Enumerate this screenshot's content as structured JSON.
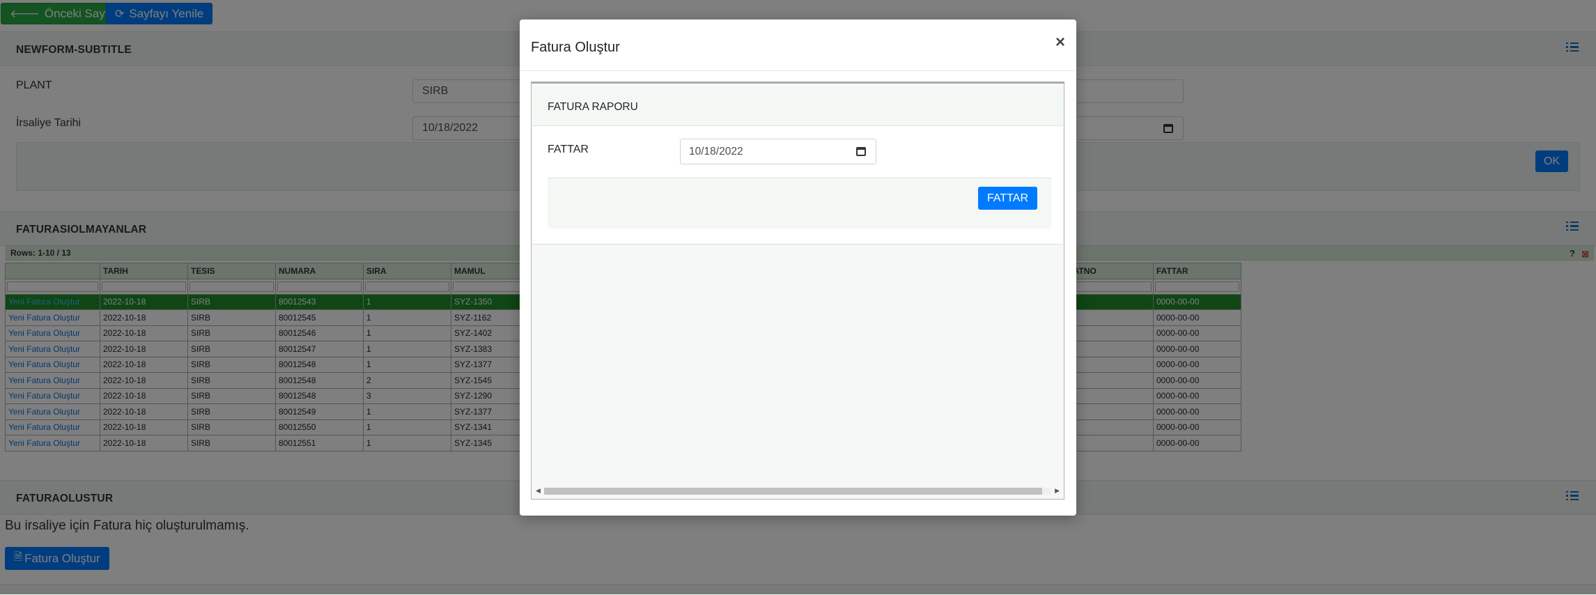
{
  "toolbar": {
    "back_label": "Önceki Sayfa",
    "refresh_label": "Sayfayı Yenile"
  },
  "form_panel": {
    "title": "NEWFORM-SUBTITLE",
    "plant_label": "PLANT",
    "plant_value": "SIRB",
    "date_label": "İrsaliye Tarihi",
    "date_value": "10/18/2022",
    "ok_label": "OK"
  },
  "report_panel": {
    "title": "FATURASIOLMAYANLAR",
    "rows_info": "Rows: 1-10 / 13",
    "help": "?",
    "columns": [
      "",
      "TARIH",
      "TESIS",
      "NUMARA",
      "SIRA",
      "MAMUL",
      "FATNO",
      "FATTAR"
    ],
    "rows": [
      {
        "link": "Yeni Fatura Oluştur",
        "tarih": "2022-10-18",
        "tesis": "SIRB",
        "numara": "80012543",
        "sira": "1",
        "mamul": "SYZ-1350",
        "fatno": "",
        "fattar": "0000-00-00"
      },
      {
        "link": "Yeni Fatura Oluştur",
        "tarih": "2022-10-18",
        "tesis": "SIRB",
        "numara": "80012545",
        "sira": "1",
        "mamul": "SYZ-1162",
        "fatno": "",
        "fattar": "0000-00-00"
      },
      {
        "link": "Yeni Fatura Oluştur",
        "tarih": "2022-10-18",
        "tesis": "SIRB",
        "numara": "80012546",
        "sira": "1",
        "mamul": "SYZ-1402",
        "fatno": "",
        "fattar": "0000-00-00"
      },
      {
        "link": "Yeni Fatura Oluştur",
        "tarih": "2022-10-18",
        "tesis": "SIRB",
        "numara": "80012547",
        "sira": "1",
        "mamul": "SYZ-1383",
        "fatno": "",
        "fattar": "0000-00-00"
      },
      {
        "link": "Yeni Fatura Oluştur",
        "tarih": "2022-10-18",
        "tesis": "SIRB",
        "numara": "80012548",
        "sira": "1",
        "mamul": "SYZ-1377",
        "fatno": "",
        "fattar": "0000-00-00"
      },
      {
        "link": "Yeni Fatura Oluştur",
        "tarih": "2022-10-18",
        "tesis": "SIRB",
        "numara": "80012548",
        "sira": "2",
        "mamul": "SYZ-1545",
        "fatno": "",
        "fattar": "0000-00-00"
      },
      {
        "link": "Yeni Fatura Oluştur",
        "tarih": "2022-10-18",
        "tesis": "SIRB",
        "numara": "80012548",
        "sira": "3",
        "mamul": "SYZ-1290",
        "fatno": "",
        "fattar": "0000-00-00"
      },
      {
        "link": "Yeni Fatura Oluştur",
        "tarih": "2022-10-18",
        "tesis": "SIRB",
        "numara": "80012549",
        "sira": "1",
        "mamul": "SYZ-1377",
        "fatno": "",
        "fattar": "0000-00-00"
      },
      {
        "link": "Yeni Fatura Oluştur",
        "tarih": "2022-10-18",
        "tesis": "SIRB",
        "numara": "80012550",
        "sira": "1",
        "mamul": "SYZ-1341",
        "fatno": "",
        "fattar": "0000-00-00"
      },
      {
        "link": "Yeni Fatura Oluştur",
        "tarih": "2022-10-18",
        "tesis": "SIRB",
        "numara": "80012551",
        "sira": "1",
        "mamul": "SYZ-1345",
        "fatno": "",
        "fattar": "0000-00-00"
      }
    ]
  },
  "bottom_panel": {
    "title": "FATURAOLUSTUR",
    "message": "Bu irsaliye için Fatura hiç oluşturulmamış.",
    "create_label": "Fatura Oluştur"
  },
  "modal": {
    "title": "Fatura Oluştur",
    "close": "×",
    "report_title": "FATURA RAPORU",
    "field_label": "FATTAR",
    "field_value": "10/18/2022",
    "button_label": "FATTAR"
  },
  "colors": {
    "primary": "#007bff",
    "success": "#28a745",
    "selected_row": "#1e8c28",
    "panel_header": "#eef5f0"
  }
}
